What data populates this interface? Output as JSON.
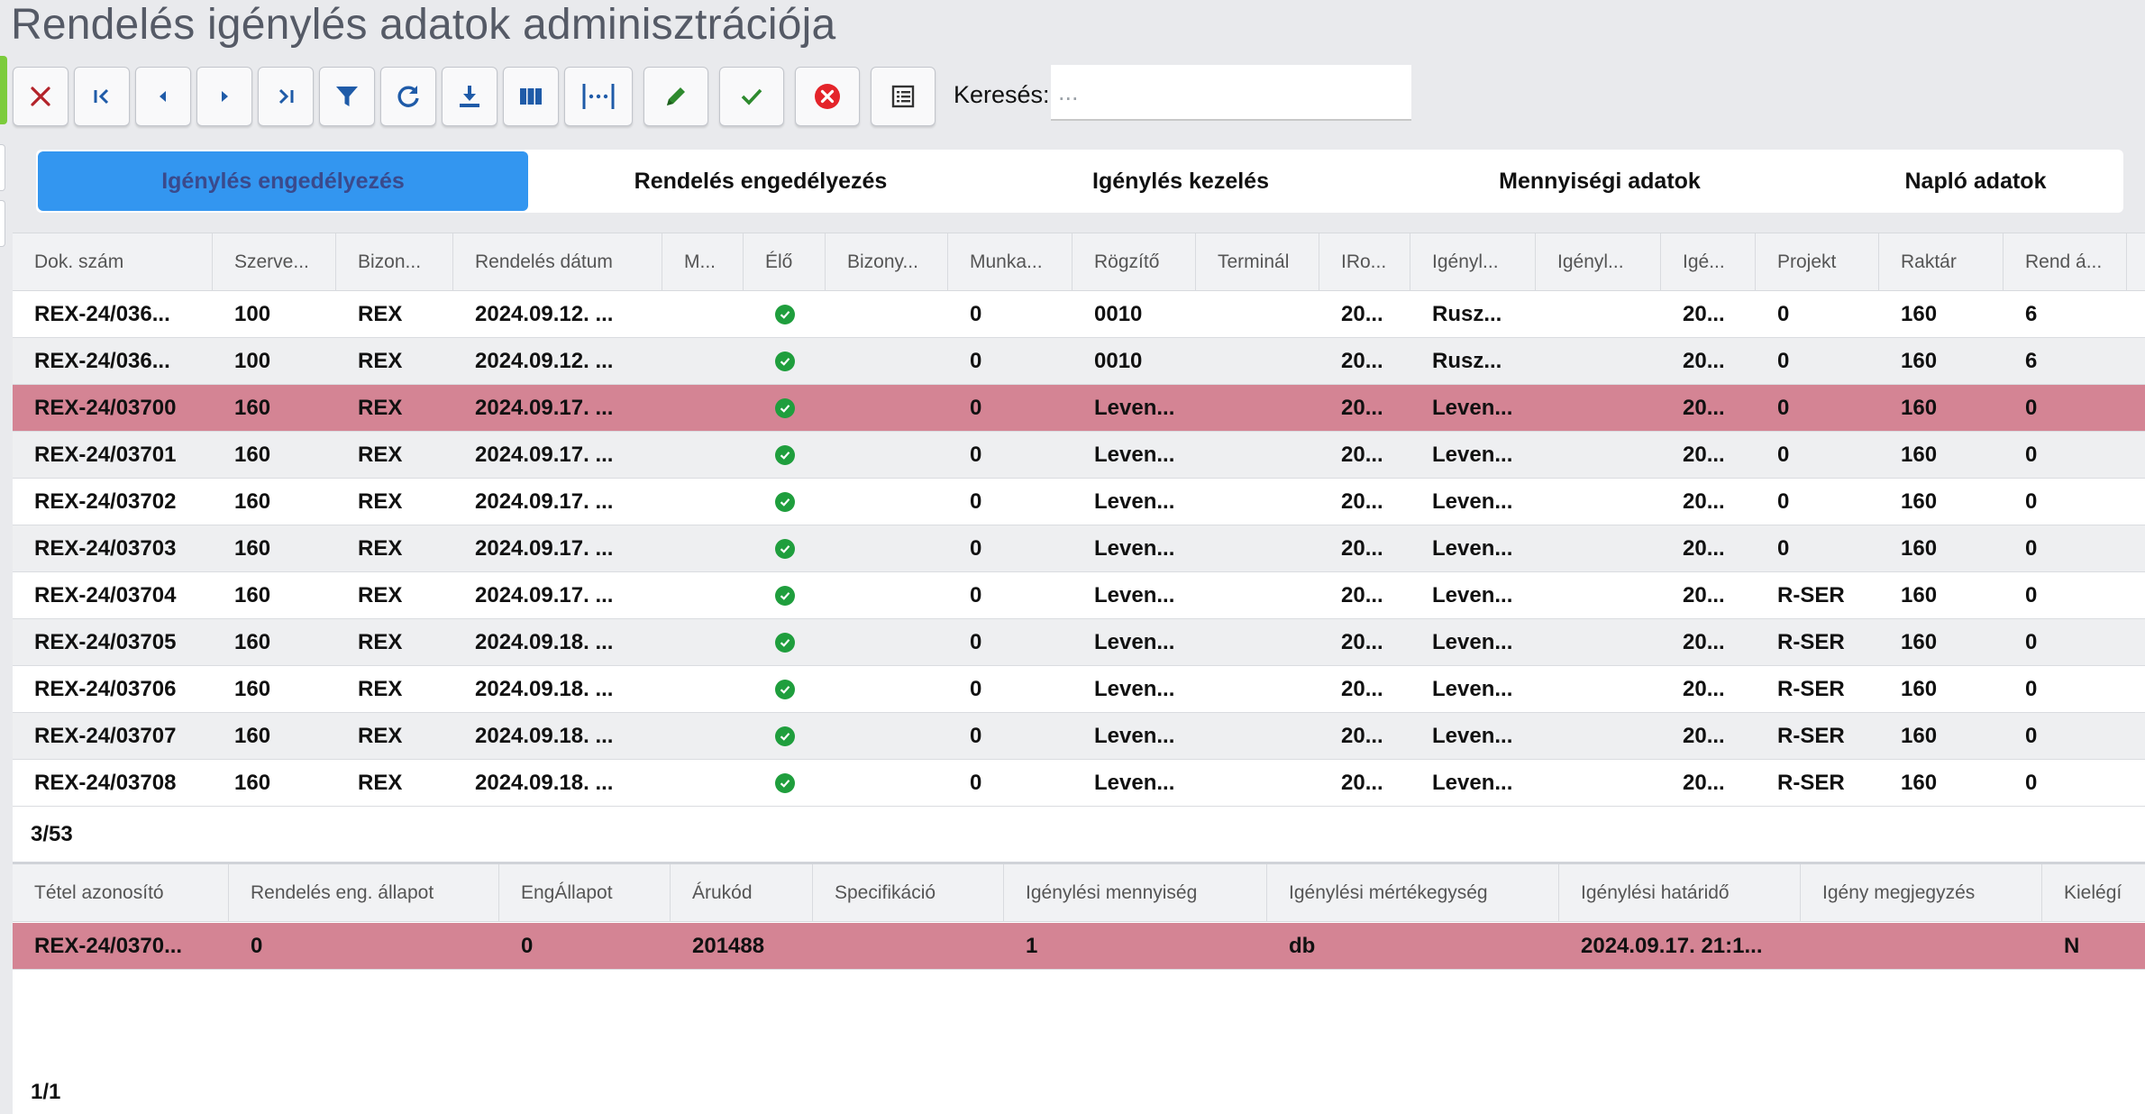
{
  "page": {
    "title": "Rendelés igénylés adatok adminisztrációja"
  },
  "toolbar": {
    "buttons": [
      {
        "name": "close-button",
        "icon": "close-icon"
      },
      {
        "name": "first-record-button",
        "icon": "first-page-icon"
      },
      {
        "name": "previous-record-button",
        "icon": "caret-left-icon"
      },
      {
        "name": "next-record-button",
        "icon": "caret-right-icon"
      },
      {
        "name": "last-record-button",
        "icon": "last-page-icon"
      },
      {
        "name": "filter-button",
        "icon": "filter-icon"
      },
      {
        "name": "refresh-button",
        "icon": "refresh-icon"
      },
      {
        "name": "download-button",
        "icon": "download-icon"
      },
      {
        "name": "columns-button",
        "icon": "columns-icon"
      },
      {
        "name": "column-width-button",
        "icon": "column-width-icon"
      },
      {
        "name": "edit-button",
        "icon": "pencil-icon"
      },
      {
        "name": "approve-button",
        "icon": "check-icon"
      },
      {
        "name": "reject-button",
        "icon": "cancel-circle-icon"
      },
      {
        "name": "list-view-button",
        "icon": "list-icon"
      }
    ],
    "search_label": "Keresés:",
    "search_placeholder": "...",
    "colors": {
      "blue_icon": "#1f5ba8",
      "red_icon": "#b3232a",
      "green_icon": "#2e8a2e",
      "red_circle": "#e4242a"
    }
  },
  "tabs": [
    {
      "label": "Igénylés engedélyezés",
      "active": true
    },
    {
      "label": "Rendelés engedélyezés",
      "active": false
    },
    {
      "label": "Igénylés kezelés",
      "active": false
    },
    {
      "label": "Mennyiségi adatok",
      "active": false
    },
    {
      "label": "Napló adatok",
      "active": false
    }
  ],
  "main_grid": {
    "columns": [
      "Dok. szám",
      "Szerve...",
      "Bizon...",
      "Rendelés dátum",
      "M...",
      "Élő",
      "Bizony...",
      "Munka...",
      "Rögzítő",
      "Terminál",
      "IRo...",
      "Igényl...",
      "Igényl...",
      "Igé...",
      "Projekt",
      "Raktár",
      "Rend á..."
    ],
    "rows": [
      {
        "cells": [
          "REX-24/036...",
          "100",
          "REX",
          "2024.09.12. ...",
          "",
          "ok",
          "",
          "0",
          "0010",
          "",
          "20...",
          "Rusz...",
          "",
          "20...",
          "0",
          "160",
          "6"
        ],
        "selected": false
      },
      {
        "cells": [
          "REX-24/036...",
          "100",
          "REX",
          "2024.09.12. ...",
          "",
          "ok",
          "",
          "0",
          "0010",
          "",
          "20...",
          "Rusz...",
          "",
          "20...",
          "0",
          "160",
          "6"
        ],
        "selected": false
      },
      {
        "cells": [
          "REX-24/03700",
          "160",
          "REX",
          "2024.09.17. ...",
          "",
          "ok",
          "",
          "0",
          "Leven...",
          "",
          "20...",
          "Leven...",
          "",
          "20...",
          "0",
          "160",
          "0"
        ],
        "selected": true
      },
      {
        "cells": [
          "REX-24/03701",
          "160",
          "REX",
          "2024.09.17. ...",
          "",
          "ok",
          "",
          "0",
          "Leven...",
          "",
          "20...",
          "Leven...",
          "",
          "20...",
          "0",
          "160",
          "0"
        ],
        "selected": false
      },
      {
        "cells": [
          "REX-24/03702",
          "160",
          "REX",
          "2024.09.17. ...",
          "",
          "ok",
          "",
          "0",
          "Leven...",
          "",
          "20...",
          "Leven...",
          "",
          "20...",
          "0",
          "160",
          "0"
        ],
        "selected": false
      },
      {
        "cells": [
          "REX-24/03703",
          "160",
          "REX",
          "2024.09.17. ...",
          "",
          "ok",
          "",
          "0",
          "Leven...",
          "",
          "20...",
          "Leven...",
          "",
          "20...",
          "0",
          "160",
          "0"
        ],
        "selected": false
      },
      {
        "cells": [
          "REX-24/03704",
          "160",
          "REX",
          "2024.09.17. ...",
          "",
          "ok",
          "",
          "0",
          "Leven...",
          "",
          "20...",
          "Leven...",
          "",
          "20...",
          "R-SER",
          "160",
          "0"
        ],
        "selected": false
      },
      {
        "cells": [
          "REX-24/03705",
          "160",
          "REX",
          "2024.09.18. ...",
          "",
          "ok",
          "",
          "0",
          "Leven...",
          "",
          "20...",
          "Leven...",
          "",
          "20...",
          "R-SER",
          "160",
          "0"
        ],
        "selected": false
      },
      {
        "cells": [
          "REX-24/03706",
          "160",
          "REX",
          "2024.09.18. ...",
          "",
          "ok",
          "",
          "0",
          "Leven...",
          "",
          "20...",
          "Leven...",
          "",
          "20...",
          "R-SER",
          "160",
          "0"
        ],
        "selected": false
      },
      {
        "cells": [
          "REX-24/03707",
          "160",
          "REX",
          "2024.09.18. ...",
          "",
          "ok",
          "",
          "0",
          "Leven...",
          "",
          "20...",
          "Leven...",
          "",
          "20...",
          "R-SER",
          "160",
          "0"
        ],
        "selected": false
      },
      {
        "cells": [
          "REX-24/03708",
          "160",
          "REX",
          "2024.09.18. ...",
          "",
          "ok",
          "",
          "0",
          "Leven...",
          "",
          "20...",
          "Leven...",
          "",
          "20...",
          "R-SER",
          "160",
          "0"
        ],
        "selected": false
      }
    ],
    "pager": "3/53"
  },
  "detail_grid": {
    "columns": [
      "Tétel azonosító",
      "Rendelés eng. állapot",
      "EngÁllapot",
      "Árukód",
      "Specifikáció",
      "Igénylési mennyiség",
      "Igénylési mértékegység",
      "Igénylési határidő",
      "Igény megjegyzés",
      "Kielégí"
    ],
    "rows": [
      {
        "cells": [
          "REX-24/0370...",
          "0",
          "0",
          "201488",
          "",
          "1",
          "db",
          "2024.09.17. 21:1...",
          "",
          "N"
        ],
        "selected": true
      }
    ],
    "pager": "1/1"
  },
  "colors": {
    "selected_row": "#d48494",
    "active_tab": "#3396f0",
    "active_tab_text": "#3a4a8c",
    "ok_icon": "#1f9e3d"
  }
}
